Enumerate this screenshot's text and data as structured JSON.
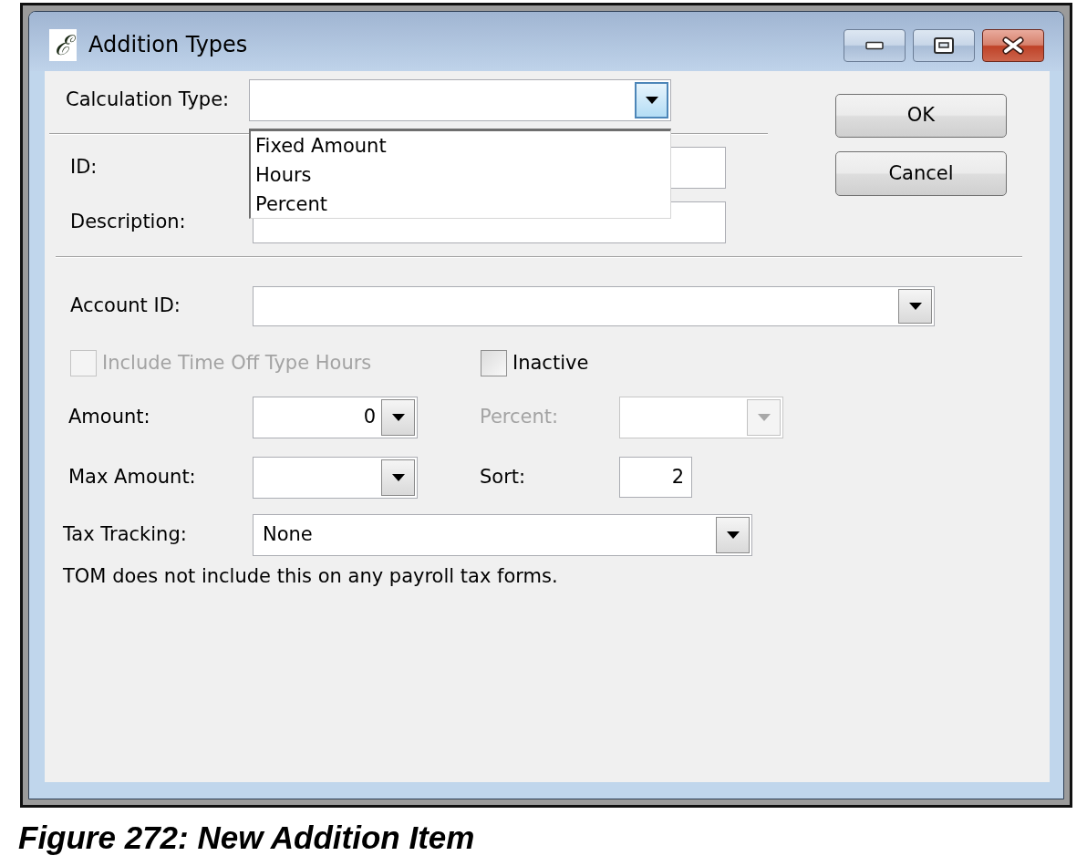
{
  "window": {
    "icon_glyph": "ℰ",
    "title": "Addition Types"
  },
  "calculation_type": {
    "label": "Calculation Type:",
    "expanded": true,
    "options": [
      {
        "label": "Fixed Amount",
        "selected": false
      },
      {
        "label": "Hours",
        "selected": false
      },
      {
        "label": "Percent",
        "selected": false
      }
    ]
  },
  "text_fields": [
    {
      "label": "ID:"
    },
    {
      "label": "Description:"
    }
  ],
  "buttons": [
    "OK",
    "Cancel"
  ],
  "account_id": {
    "label": "Account ID:"
  },
  "checkboxes": [
    {
      "label": "Include Time Off Type Hours",
      "checked": false,
      "disabled": true
    },
    {
      "label": "Inactive",
      "checked": false,
      "disabled": false
    }
  ],
  "amount_fields": [
    {
      "label": "Amount:",
      "kind": "combo",
      "value": "0",
      "disabled": false
    },
    {
      "label": "Percent:",
      "kind": "combo",
      "disabled": true
    },
    {
      "label": "Max Amount:",
      "kind": "combo",
      "disabled": false
    },
    {
      "label": "Sort:",
      "kind": "text",
      "value": "2",
      "disabled": false
    }
  ],
  "tax_tracking": {
    "label": "Tax Tracking:",
    "value": "None"
  },
  "note": "TOM does not include this on any payroll tax forms.",
  "caption": "Figure 272: New Addition Item"
}
